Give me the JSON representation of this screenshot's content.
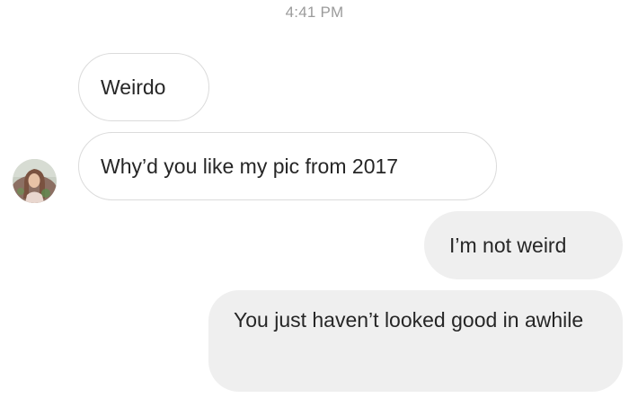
{
  "thread": {
    "timestamp": "4:41 PM",
    "messages": [
      {
        "sender": "them",
        "text": "Weirdo"
      },
      {
        "sender": "them",
        "text": "Why’d you like my pic from 2017"
      },
      {
        "sender": "me",
        "text": "I’m not weird"
      },
      {
        "sender": "me",
        "text": "You just haven’t looked good in awhile"
      }
    ]
  },
  "colors": {
    "incoming_bubble_bg": "#ffffff",
    "incoming_bubble_border": "#dbdbdb",
    "outgoing_bubble_bg": "#efefef",
    "message_text": "#262626",
    "timestamp_text": "#9b9b9b"
  },
  "avatar": {
    "icon": "profile-photo-avatar"
  }
}
